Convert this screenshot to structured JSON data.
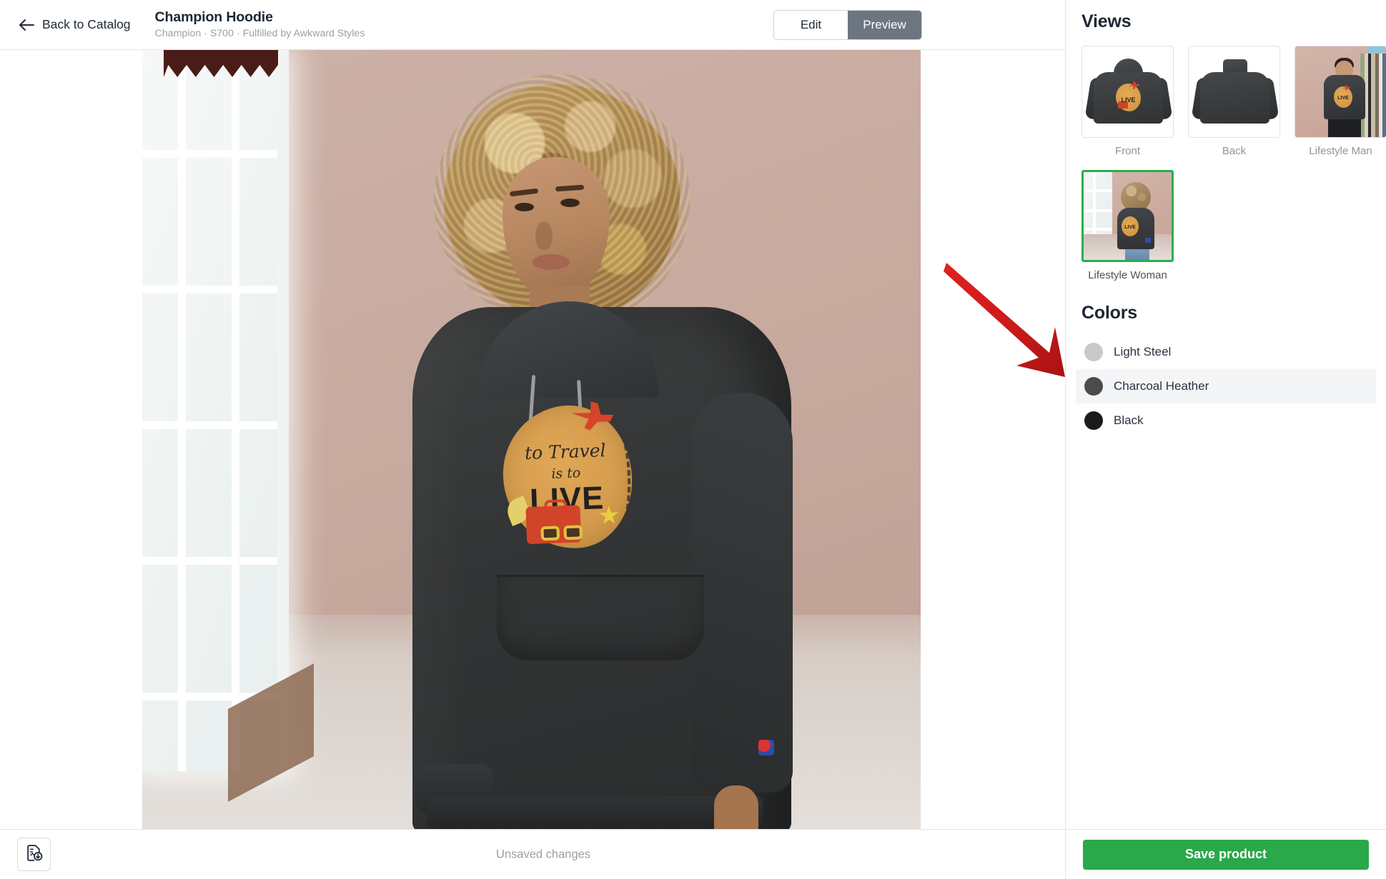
{
  "header": {
    "back_label": "Back to Catalog",
    "back_icon": "arrow-left-icon",
    "product_title": "Champion Hoodie",
    "product_subtitle": "Champion · S700 · Fulfilled by Awkward Styles",
    "mode_tabs": [
      {
        "label": "Edit",
        "active": false
      },
      {
        "label": "Preview",
        "active": true
      }
    ]
  },
  "canvas": {
    "design_text_line1": "to Travel",
    "design_text_line2": "is to",
    "design_text_line3": "LIVE",
    "annotation": {
      "type": "arrow",
      "color": "#d81f1f",
      "points_to": "Colors"
    }
  },
  "footer": {
    "download_icon": "download-image-icon",
    "status_text": "Unsaved changes"
  },
  "sidebar": {
    "views": {
      "title": "Views",
      "items": [
        {
          "label": "Front",
          "selected": false
        },
        {
          "label": "Back",
          "selected": false
        },
        {
          "label": "Lifestyle Man",
          "selected": false
        },
        {
          "label": "Lifestyle Woman",
          "selected": true
        }
      ]
    },
    "colors": {
      "title": "Colors",
      "items": [
        {
          "label": "Light Steel",
          "hex": "#c9c9c9",
          "selected": false
        },
        {
          "label": "Charcoal Heather",
          "hex": "#4b4b4b",
          "selected": true
        },
        {
          "label": "Black",
          "hex": "#1b1b1b",
          "selected": false
        }
      ]
    },
    "save_label": "Save product",
    "accent_green": "#2aa84a",
    "selection_green": "#2aae4f"
  }
}
